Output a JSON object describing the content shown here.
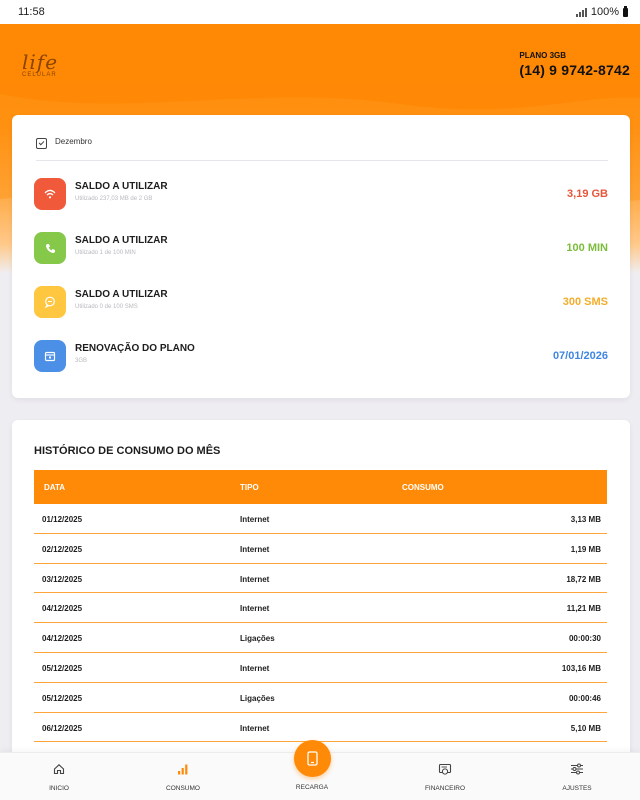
{
  "status_bar": {
    "time": "11:58",
    "battery": "100%"
  },
  "header": {
    "logo_word": "life",
    "logo_sub": "CELULAR",
    "plan_name": "PLANO 3GB",
    "phone": "(14) 9 9742-8742"
  },
  "balance": {
    "month": "Dezembro",
    "items": [
      {
        "icon": "wifi-icon",
        "title": "SALDO A UTILIZAR",
        "subtitle": "Utilizado 237,03 MB de 2 GB",
        "value": "3,19 GB",
        "color": "#f05a3a",
        "value_color": "#e8553a"
      },
      {
        "icon": "phone-icon",
        "title": "SALDO A UTILIZAR",
        "subtitle": "Utilizado 1 de 100 MIN",
        "value": "100 MIN",
        "color": "#86c84a",
        "value_color": "#7cbc3d"
      },
      {
        "icon": "message-icon",
        "title": "SALDO A UTILIZAR",
        "subtitle": "Utilizado 0 de 100 SMS",
        "value": "300 SMS",
        "color": "#ffc640",
        "value_color": "#f3ad2a"
      },
      {
        "icon": "calendar-icon",
        "title": "RENOVAÇÃO DO PLANO",
        "subtitle": "3GB",
        "value": "07/01/2026",
        "color": "#4c8fe6",
        "value_color": "#3f86e3"
      }
    ]
  },
  "history": {
    "title": "HISTÓRICO DE CONSUMO DO MÊS",
    "columns": {
      "date": "DATA",
      "type": "TIPO",
      "consumption": "CONSUMO"
    },
    "rows": [
      {
        "date": "01/12/2025",
        "type": "Internet",
        "consumption": "3,13 MB"
      },
      {
        "date": "02/12/2025",
        "type": "Internet",
        "consumption": "1,19 MB"
      },
      {
        "date": "03/12/2025",
        "type": "Internet",
        "consumption": "18,72 MB"
      },
      {
        "date": "04/12/2025",
        "type": "Internet",
        "consumption": "11,21 MB"
      },
      {
        "date": "04/12/2025",
        "type": "Ligações",
        "consumption": "00:00:30"
      },
      {
        "date": "05/12/2025",
        "type": "Internet",
        "consumption": "103,16 MB"
      },
      {
        "date": "05/12/2025",
        "type": "Ligações",
        "consumption": "00:00:46"
      },
      {
        "date": "06/12/2025",
        "type": "Internet",
        "consumption": "5,10 MB"
      }
    ]
  },
  "nav": {
    "accent": "#ff8a08",
    "items": [
      {
        "label": "INICIO",
        "icon": "home-icon"
      },
      {
        "label": "CONSUMO",
        "icon": "bar-chart-icon"
      },
      {
        "label": "RECARGA",
        "icon": "mobile-phone-icon"
      },
      {
        "label": "FINANCEIRO",
        "icon": "invoice-icon"
      },
      {
        "label": "AJUSTES",
        "icon": "sliders-icon"
      }
    ]
  }
}
